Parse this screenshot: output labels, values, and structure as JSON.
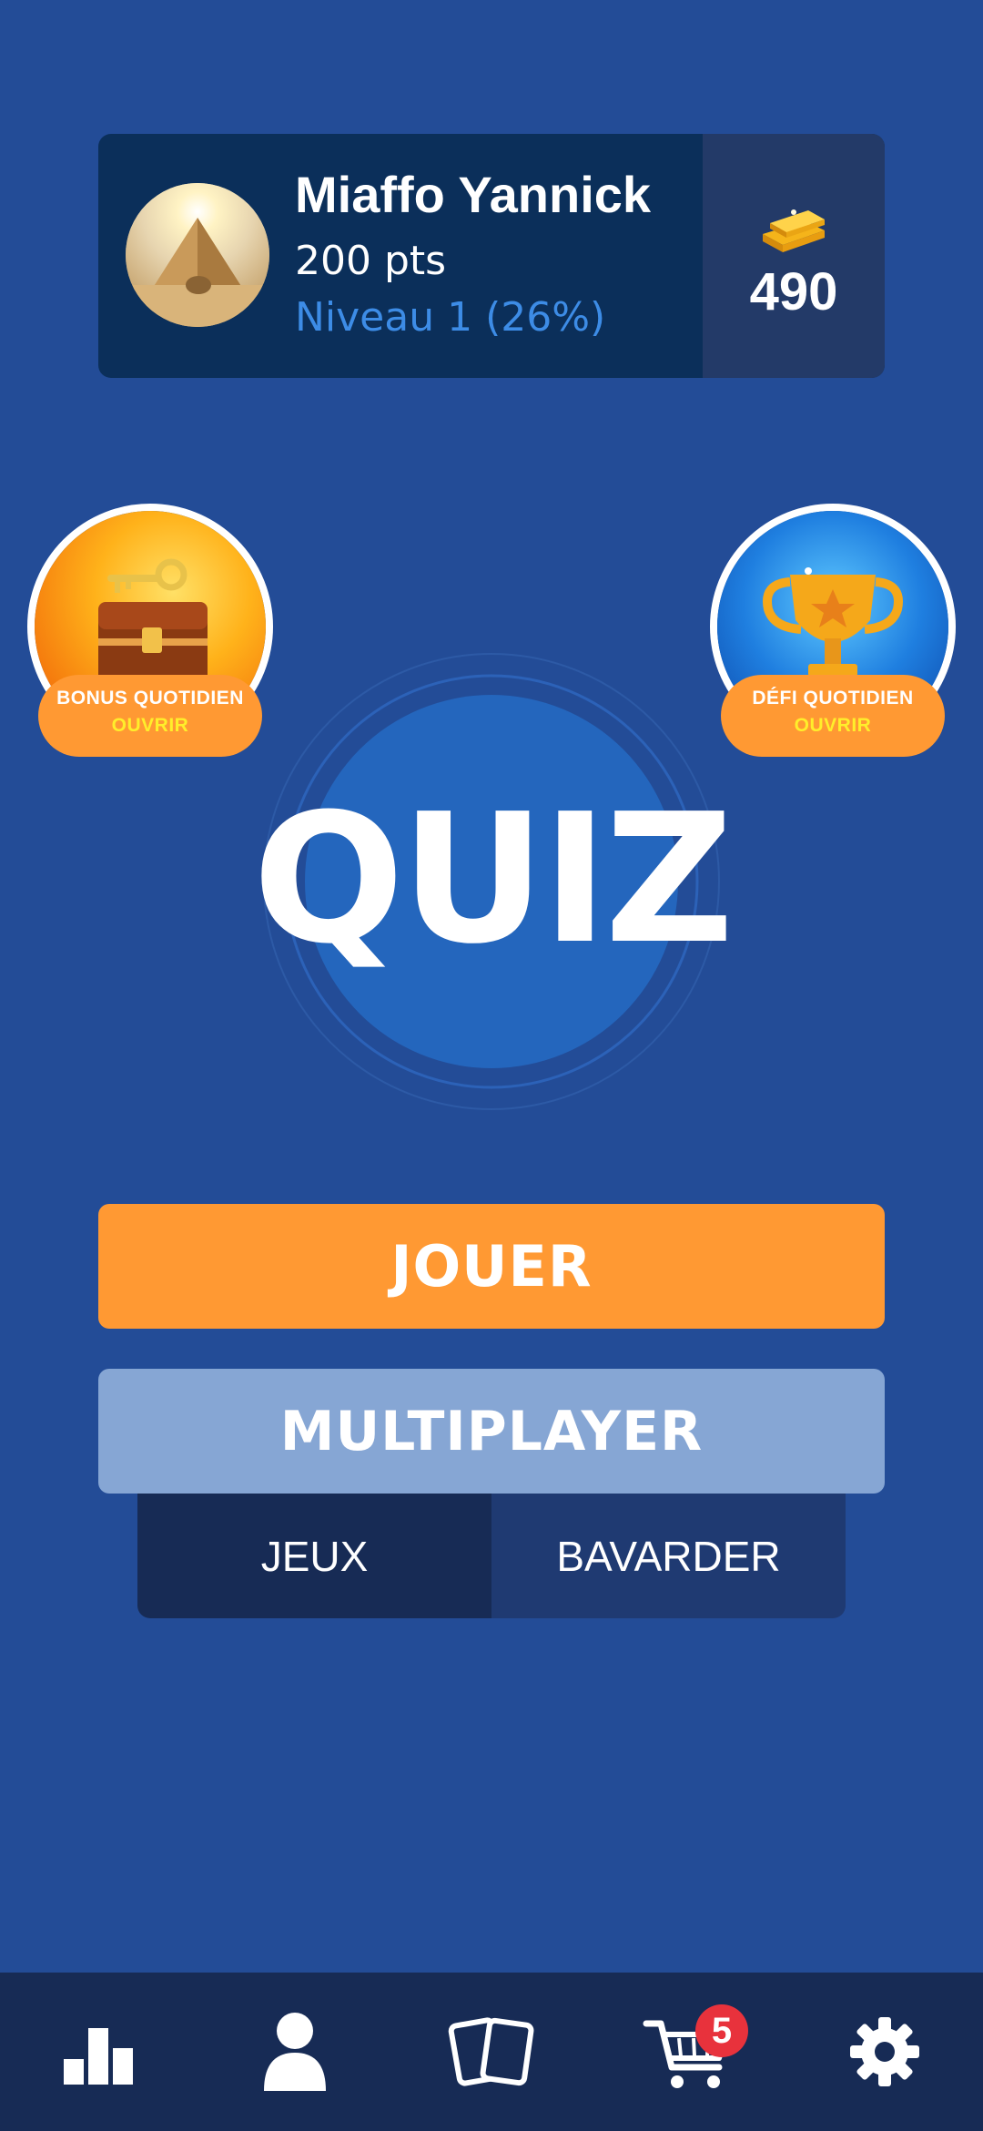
{
  "profile": {
    "name": "Miaffo Yannick",
    "points": "200 pts",
    "level": "Niveau 1 (26%)",
    "coins": "490",
    "avatar_icon": "pyramid-avatar-icon",
    "coins_icon": "gold-bars-icon"
  },
  "daily_bonus": {
    "title": "BONUS QUOTIDIEN",
    "action": "OUVRIR",
    "icon": "treasure-chest-icon"
  },
  "daily_challenge": {
    "title": "DÉFI QUOTIDIEN",
    "action": "OUVRIR",
    "icon": "trophy-icon"
  },
  "logo": {
    "text": "QUIZ"
  },
  "buttons": {
    "play": "JOUER",
    "multiplayer": "MULTIPLAYER"
  },
  "multiplayer_tabs": [
    {
      "label": "JEUX",
      "active": true
    },
    {
      "label": "BAVARDER",
      "active": false
    }
  ],
  "bottom_nav": {
    "items": [
      {
        "icon": "leaderboard-icon"
      },
      {
        "icon": "profile-icon"
      },
      {
        "icon": "cards-icon"
      },
      {
        "icon": "cart-icon",
        "badge": "5"
      },
      {
        "icon": "settings-icon"
      }
    ]
  },
  "colors": {
    "background": "#234c97",
    "accent_orange": "#ff9933",
    "level_blue": "#3d8ce6",
    "badge_red": "#e8323c"
  }
}
